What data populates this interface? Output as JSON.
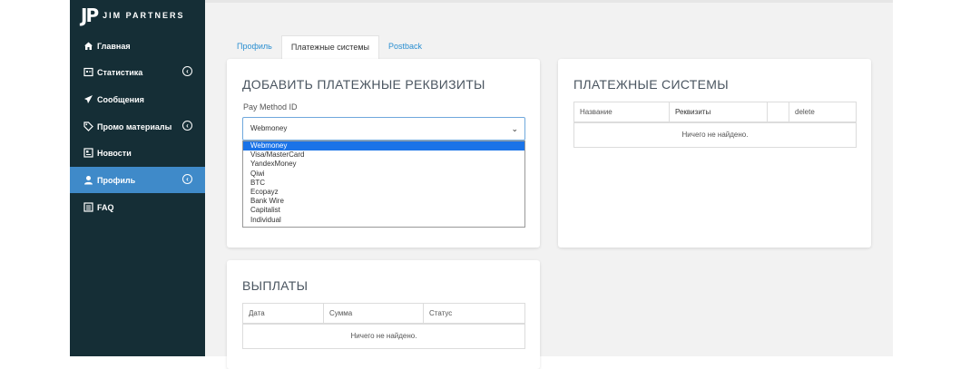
{
  "brand": {
    "mark": "JP",
    "name": "JIM PARTNERS"
  },
  "sidebar": {
    "items": [
      {
        "label": "Главная",
        "icon": "home-icon",
        "arrow": false
      },
      {
        "label": "Статистика",
        "icon": "stats-icon",
        "arrow": true
      },
      {
        "label": "Сообщения",
        "icon": "paper-plane-icon",
        "arrow": false
      },
      {
        "label": "Промо материалы",
        "icon": "tag-icon",
        "arrow": true
      },
      {
        "label": "Новости",
        "icon": "newspaper-icon",
        "arrow": false
      },
      {
        "label": "Профиль",
        "icon": "user-icon",
        "arrow": true,
        "active": true
      },
      {
        "label": "FAQ",
        "icon": "list-icon",
        "arrow": false
      }
    ]
  },
  "tabs": [
    {
      "label": "Профиль"
    },
    {
      "label": "Платежные системы",
      "active": true
    },
    {
      "label": "Postback"
    }
  ],
  "add_card": {
    "title": "ДОБАВИТЬ ПЛАТЕЖНЫЕ РЕКВИЗИТЫ",
    "field_label": "Pay Method ID",
    "selected": "Webmoney",
    "options": [
      "Webmoney",
      "Visa/MasterCard",
      "YandexMoney",
      "Qiwi",
      "BTC",
      "Ecopayz",
      "Bank Wire",
      "Capitalist",
      "Individual"
    ]
  },
  "systems_card": {
    "title": "ПЛАТЕЖНЫЕ СИСТЕМЫ",
    "columns": [
      "Название",
      "Реквизиты",
      "",
      "delete"
    ],
    "empty": "Ничего не найдено."
  },
  "payouts_card": {
    "title": "ВЫПЛАТЫ",
    "columns": [
      "Дата",
      "Сумма",
      "Статус"
    ],
    "empty": "Ничего не найдено."
  },
  "colors": {
    "sidebar": "#152e36",
    "active": "#3f8ac9",
    "link": "#2b8fd1"
  }
}
